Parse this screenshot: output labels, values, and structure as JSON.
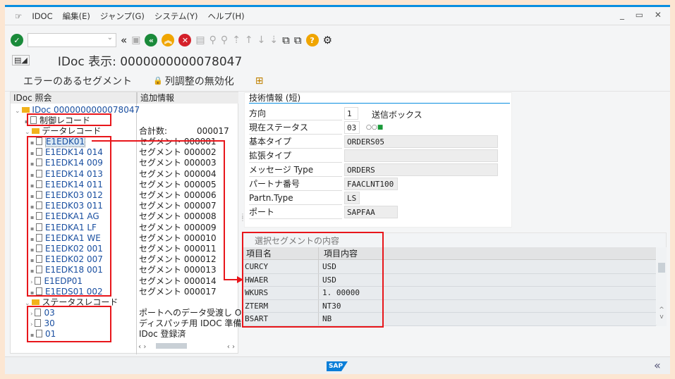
{
  "menu": {
    "items": [
      "IDOC",
      "編集(E)",
      "ジャンプ(G)",
      "システム(Y)",
      "ヘルプ(H)"
    ],
    "window_controls": "_ ▭ ✕"
  },
  "title": "IDoc 表示: 0000000000078047",
  "app_toolbar": {
    "errors": "エラーのあるセグメント",
    "disable_col": "列調整の無効化"
  },
  "tree": {
    "header": "IDoc 照会",
    "info_header": "追加情報",
    "root": "IDoc 0000000000078047",
    "control": "制御レコード",
    "data": "データレコード",
    "total_label": "合計数:",
    "total": "000017",
    "segments": [
      {
        "name": "E1EDK01",
        "info": "セグメント 000001"
      },
      {
        "name": "E1EDK14 014",
        "info": "セグメント 000002"
      },
      {
        "name": "E1EDK14 009",
        "info": "セグメント 000003"
      },
      {
        "name": "E1EDK14 013",
        "info": "セグメント 000004"
      },
      {
        "name": "E1EDK14 011",
        "info": "セグメント 000005"
      },
      {
        "name": "E1EDK03 012",
        "info": "セグメント 000006"
      },
      {
        "name": "E1EDK03 011",
        "info": "セグメント 000007"
      },
      {
        "name": "E1EDKA1 AG",
        "info": "セグメント 000008"
      },
      {
        "name": "E1EDKA1 LF",
        "info": "セグメント 000009"
      },
      {
        "name": "E1EDKA1 WE",
        "info": "セグメント 000010"
      },
      {
        "name": "E1EDK02 001",
        "info": "セグメント 000011"
      },
      {
        "name": "E1EDK02 007",
        "info": "セグメント 000012"
      },
      {
        "name": "E1EDK18 001",
        "info": "セグメント 000013"
      },
      {
        "name": "E1EDP01",
        "info": "セグメント 000014"
      },
      {
        "name": "E1EDS01 002",
        "info": "セグメント 000017"
      }
    ],
    "status": "ステータスレコード",
    "statuses": [
      {
        "name": "03",
        "info": "ポートへのデータ受渡し OK"
      },
      {
        "name": "30",
        "info": "ディスパッチ用 IDOC 準備完"
      },
      {
        "name": "01",
        "info": "IDoc 登録済"
      }
    ]
  },
  "tech": {
    "title": "技術情報 (短)",
    "outbox": "送信ボックス",
    "fields": [
      {
        "label": "方向",
        "value": "1"
      },
      {
        "label": "現在ステータス",
        "value": "03"
      },
      {
        "label": "基本タイプ",
        "value": "ORDERS05"
      },
      {
        "label": "拡張タイプ",
        "value": ""
      },
      {
        "label": "メッセージ Type",
        "value": "ORDERS"
      },
      {
        "label": "パートナ番号",
        "value": "FAACLNT100"
      },
      {
        "label": "Partn.Type",
        "value": "LS"
      },
      {
        "label": "ポート",
        "value": "SAPFAA"
      }
    ]
  },
  "segment_content": {
    "title": "選択セグメントの内容",
    "col_name": "項目名",
    "col_value": "項目内容",
    "rows": [
      {
        "name": "CURCY",
        "value": "USD"
      },
      {
        "name": "HWAER",
        "value": "USD"
      },
      {
        "name": "WKURS",
        "value": "1. 00000"
      },
      {
        "name": "ZTERM",
        "value": "NT30"
      },
      {
        "name": "BSART",
        "value": "NB"
      }
    ]
  },
  "footer": {
    "logo": "SAP"
  },
  "colors": {
    "accent": "#0a8ee0",
    "annotation": "#e8161b",
    "link": "#1a4fa0"
  }
}
